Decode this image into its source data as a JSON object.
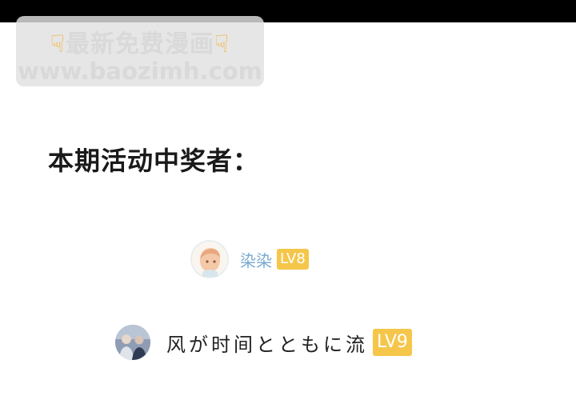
{
  "watermark": {
    "line1": "最新免费漫画",
    "line2": "www.baozimh.com",
    "hand_icon": "pointing-down-hand-icon"
  },
  "heading": "本期活动中奖者：",
  "winners": [
    {
      "name": "染染",
      "level": "LV8",
      "avatar": "anime-girl-avatar"
    },
    {
      "name": "风が时间とともに流",
      "level": "LV9",
      "avatar": "people-photo-avatar"
    }
  ],
  "colors": {
    "badge": "#f5c64a",
    "name_blue": "#7aa9cf",
    "heading": "#1a1a1a"
  }
}
